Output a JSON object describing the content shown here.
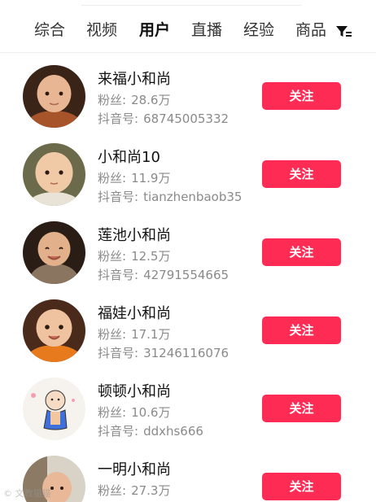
{
  "tabs": [
    {
      "label": "综合",
      "active": false
    },
    {
      "label": "视频",
      "active": false
    },
    {
      "label": "用户",
      "active": true
    },
    {
      "label": "直播",
      "active": false
    },
    {
      "label": "经验",
      "active": false
    },
    {
      "label": "商品",
      "active": false
    }
  ],
  "filter_icon": "filter-icon",
  "fans_label": "粉丝:",
  "douyin_label": "抖音号:",
  "follow_label": "关注",
  "accent_color": "#fe2c55",
  "users": [
    {
      "name": "来福小和尚",
      "fans": "28.6万",
      "douyin_id": "68745005332"
    },
    {
      "name": "小和尚10",
      "fans": "11.9万",
      "douyin_id": "tianzhenbaob35"
    },
    {
      "name": "莲池小和尚",
      "fans": "12.5万",
      "douyin_id": "42791554665"
    },
    {
      "name": "福娃小和尚",
      "fans": "17.1万",
      "douyin_id": "31246116076"
    },
    {
      "name": "顿顿小和尚",
      "fans": "10.6万",
      "douyin_id": "ddxhs666"
    },
    {
      "name": "一明小和尚",
      "fans": "27.3万",
      "douyin_id": ""
    }
  ],
  "watermark": "© 文教猫猫"
}
